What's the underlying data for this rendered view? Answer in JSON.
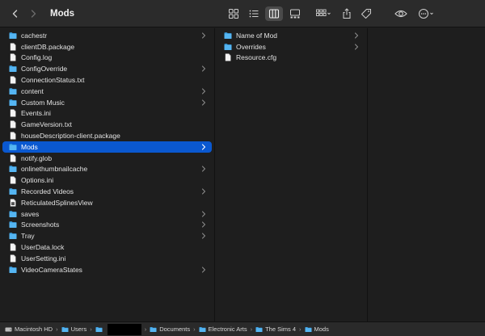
{
  "window": {
    "title": "Mods"
  },
  "colors": {
    "folder": "#3fa4e6",
    "selection": "#0a58d0",
    "background": "#1e1e1e"
  },
  "toolbar": {
    "back_icon": "chevron-left-icon",
    "forward_icon": "chevron-right-icon",
    "view_icons": [
      "icon-view-icon",
      "list-view-icon",
      "column-view-icon",
      "gallery-view-icon"
    ],
    "active_view": "column",
    "group_icon": "group-icon",
    "share_icon": "share-icon",
    "tags_icon": "tag-icon",
    "preview_icon": "eye-icon",
    "more_icon": "ellipsis-icon"
  },
  "column1": {
    "items": [
      {
        "label": "cachestr",
        "kind": "folder",
        "arrow": true
      },
      {
        "label": "clientDB.package",
        "kind": "file",
        "arrow": false
      },
      {
        "label": "Config.log",
        "kind": "file",
        "arrow": false
      },
      {
        "label": "ConfigOverride",
        "kind": "folder",
        "arrow": true
      },
      {
        "label": "ConnectionStatus.txt",
        "kind": "file",
        "arrow": false
      },
      {
        "label": "content",
        "kind": "folder",
        "arrow": true
      },
      {
        "label": "Custom Music",
        "kind": "folder",
        "arrow": true
      },
      {
        "label": "Events.ini",
        "kind": "file",
        "arrow": false
      },
      {
        "label": "GameVersion.txt",
        "kind": "file",
        "arrow": false
      },
      {
        "label": "houseDescription-client.package",
        "kind": "file",
        "arrow": false
      },
      {
        "label": "Mods",
        "kind": "folder",
        "arrow": true,
        "selected": true
      },
      {
        "label": "notify.glob",
        "kind": "file",
        "arrow": false
      },
      {
        "label": "onlinethumbnailcache",
        "kind": "folder",
        "arrow": true
      },
      {
        "label": "Options.ini",
        "kind": "file",
        "arrow": false
      },
      {
        "label": "Recorded Videos",
        "kind": "folder",
        "arrow": true
      },
      {
        "label": "ReticulatedSplinesView",
        "kind": "doc",
        "arrow": false
      },
      {
        "label": "saves",
        "kind": "folder",
        "arrow": true
      },
      {
        "label": "Screenshots",
        "kind": "folder",
        "arrow": true
      },
      {
        "label": "Tray",
        "kind": "folder",
        "arrow": true
      },
      {
        "label": "UserData.lock",
        "kind": "file",
        "arrow": false
      },
      {
        "label": "UserSetting.ini",
        "kind": "file",
        "arrow": false
      },
      {
        "label": "VideoCameraStates",
        "kind": "folder",
        "arrow": true
      }
    ]
  },
  "column2": {
    "items": [
      {
        "label": "Name of Mod",
        "kind": "folder",
        "arrow": true
      },
      {
        "label": "Overrides",
        "kind": "folder",
        "arrow": true
      },
      {
        "label": "Resource.cfg",
        "kind": "file",
        "arrow": false
      }
    ]
  },
  "pathbar": {
    "crumbs": [
      {
        "label": "Macintosh HD",
        "kind": "disk"
      },
      {
        "label": "Users",
        "kind": "folder"
      },
      {
        "label": "",
        "kind": "redacted"
      },
      {
        "label": "Documents",
        "kind": "folder"
      },
      {
        "label": "Electronic Arts",
        "kind": "folder"
      },
      {
        "label": "The Sims 4",
        "kind": "folder"
      },
      {
        "label": "Mods",
        "kind": "folder"
      }
    ]
  }
}
